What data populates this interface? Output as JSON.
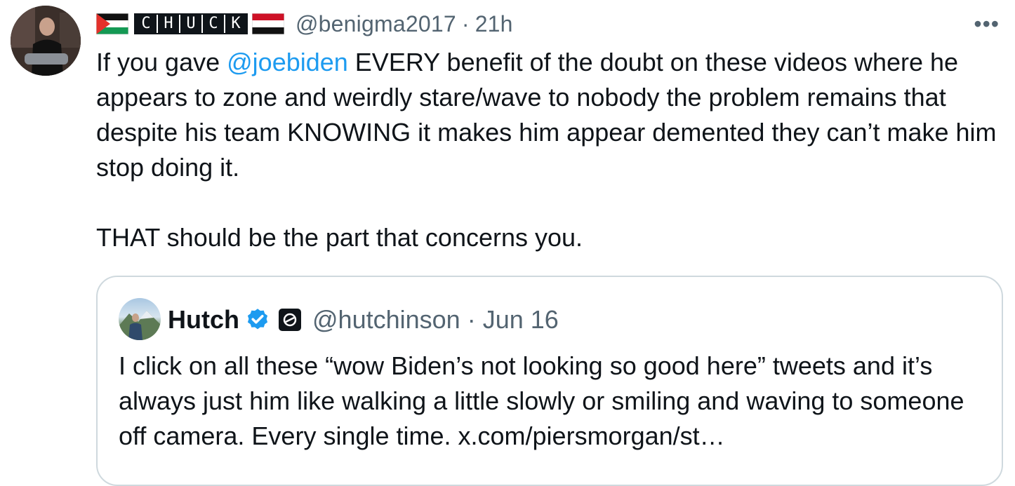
{
  "tweet": {
    "author": {
      "display_name_letters": [
        "C",
        "H",
        "U",
        "C",
        "K"
      ],
      "handle": "@benigma2017",
      "separator": "·",
      "time": "21h",
      "flags": [
        "palestine-flag",
        "yemen-flag"
      ]
    },
    "more_label": "•••",
    "body": {
      "lead": "If you gave ",
      "mention": "@joebiden",
      "rest": " EVERY benefit of the doubt on these videos where he appears to zone and weirdly stare/wave to nobody the problem remains that despite his team KNOWING it makes him appear demented they can’t make him stop doing it.",
      "paragraph2": "THAT should be the part that concerns you."
    }
  },
  "quote": {
    "name": "Hutch",
    "handle": "@hutchinson",
    "separator": "·",
    "date": "Jun 16",
    "text": "I click on all these “wow Biden’s not looking so good here” tweets and it’s always just him like walking a little slowly or smiling and waving to someone off camera. Every single time. x.com/piersmorgan/st…"
  },
  "colors": {
    "text": "#0f1419",
    "secondary": "#536471",
    "link": "#1d9bf0",
    "border": "#cfd9de",
    "verified": "#1d9bf0"
  }
}
